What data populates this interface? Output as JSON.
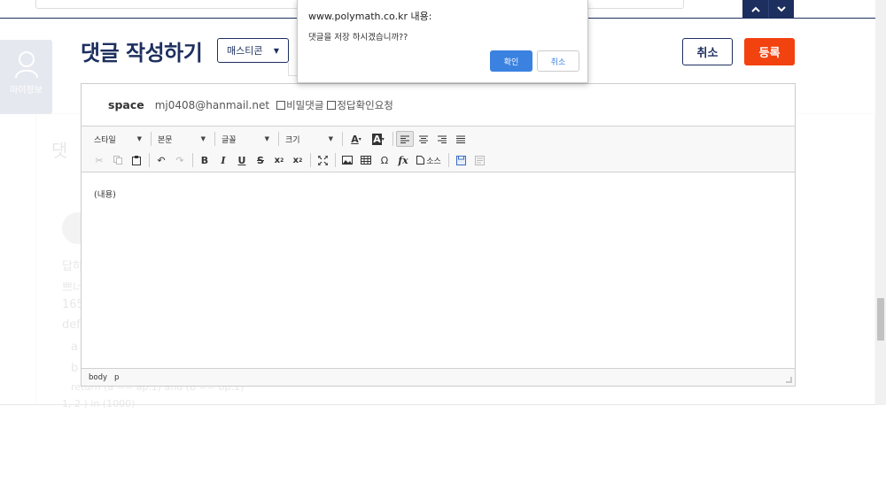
{
  "background": {
    "myinfo_label": "마이정보",
    "faded_heading": "댓",
    "faded_lines": [
      "답하",
      "쁘너",
      "165",
      "def",
      "a",
      "b",
      "return (a == ap.1) and (b == bp.1)",
      "1, 2 ) in (1000)"
    ]
  },
  "nav": {
    "up_icon": "chevron-up-icon",
    "down_icon": "chevron-down-icon"
  },
  "header": {
    "title": "댓글 작성하기",
    "emoticon_label": "매스티콘",
    "cancel_label": "취소",
    "register_label": "등록"
  },
  "author": {
    "name": "space",
    "email": "mj0408@hanmail.net",
    "secret_label": "비밀댓글",
    "answer_check_label": "정답확인요청"
  },
  "toolbar": {
    "combos": [
      "스타일",
      "본문",
      "글꼴",
      "크기"
    ],
    "source_label": "소스"
  },
  "editor": {
    "content": "(내용)",
    "path": [
      "body",
      "p"
    ]
  },
  "dialog": {
    "title": "www.polymath.co.kr 내용:",
    "message": "댓글을 저장 하시겠습니까??",
    "ok_label": "확인",
    "cancel_label": "취소"
  },
  "colors": {
    "navy": "#1c2f5e",
    "register": "#f2420f",
    "dialog_ok": "#3b82e0"
  }
}
